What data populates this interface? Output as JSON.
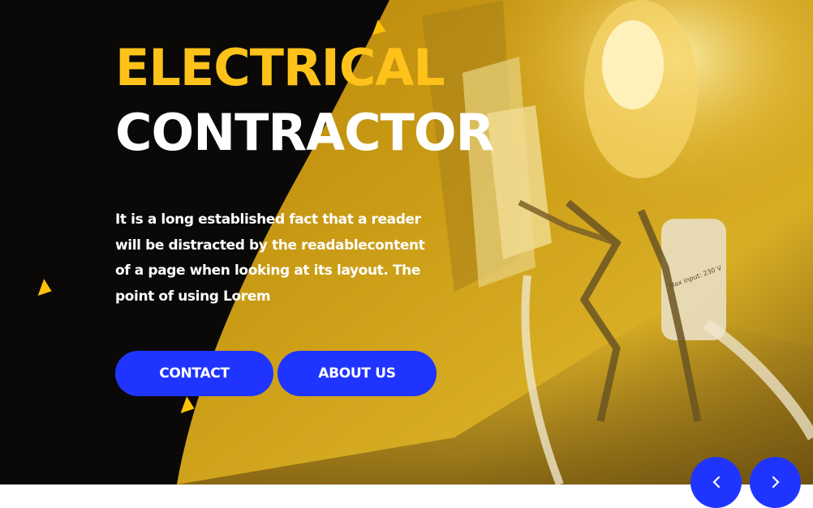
{
  "hero": {
    "title_line1": "ELECTRICAL",
    "title_line2": "CONTRACTOR",
    "description": "It is a long established fact that a reader will be distracted by the readablecontent of a page when looking at its layout. The point of using Lorem",
    "image_text": "Max input: 230 V"
  },
  "buttons": {
    "contact_label": "CONTACT",
    "about_label": "ABOUT US"
  },
  "slider": {
    "prev_icon": "chevron-left-icon",
    "next_icon": "chevron-right-icon"
  },
  "colors": {
    "accent_yellow": "#ffc21a",
    "button_blue": "#1f35ff",
    "dark_bg": "#0b0908",
    "white": "#ffffff"
  }
}
